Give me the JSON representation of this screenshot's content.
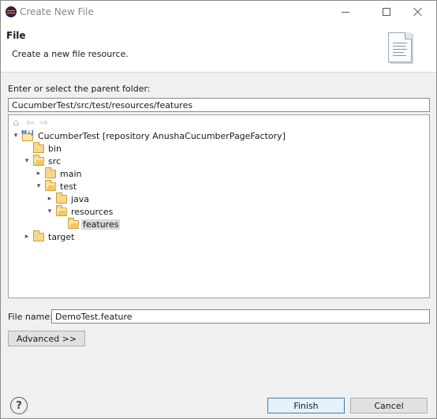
{
  "window": {
    "title": "Create New File"
  },
  "header": {
    "title": "File",
    "description": "Create a new file resource."
  },
  "parent_folder": {
    "label": "Enter or select the parent folder:",
    "value": "CucumberTest/src/test/resources/features"
  },
  "tree": {
    "toolbar": [
      "home-icon",
      "back-arrow-icon",
      "forward-arrow-icon"
    ],
    "items": [
      {
        "label": "CucumberTest [repository AnushaCucumberPageFactory]",
        "expanded": true,
        "type": "project"
      },
      {
        "label": "bin",
        "expanded": false,
        "type": "folder"
      },
      {
        "label": "src",
        "expanded": true,
        "type": "folder"
      },
      {
        "label": "main",
        "expanded": false,
        "type": "folder"
      },
      {
        "label": "test",
        "expanded": true,
        "type": "folder"
      },
      {
        "label": "java",
        "expanded": false,
        "type": "folder"
      },
      {
        "label": "resources",
        "expanded": true,
        "type": "folder"
      },
      {
        "label": "features",
        "expanded": false,
        "type": "folder",
        "selected": true
      },
      {
        "label": "target",
        "expanded": false,
        "type": "folder"
      }
    ]
  },
  "file_name": {
    "label": "File name:",
    "value": "DemoTest.feature"
  },
  "buttons": {
    "advanced": "Advanced >>",
    "finish": "Finish",
    "cancel": "Cancel",
    "help": "?"
  },
  "colors": {
    "folder": "#f7d78a",
    "selection": "#d9d9d9",
    "default_button_border": "#3c7fb1"
  }
}
